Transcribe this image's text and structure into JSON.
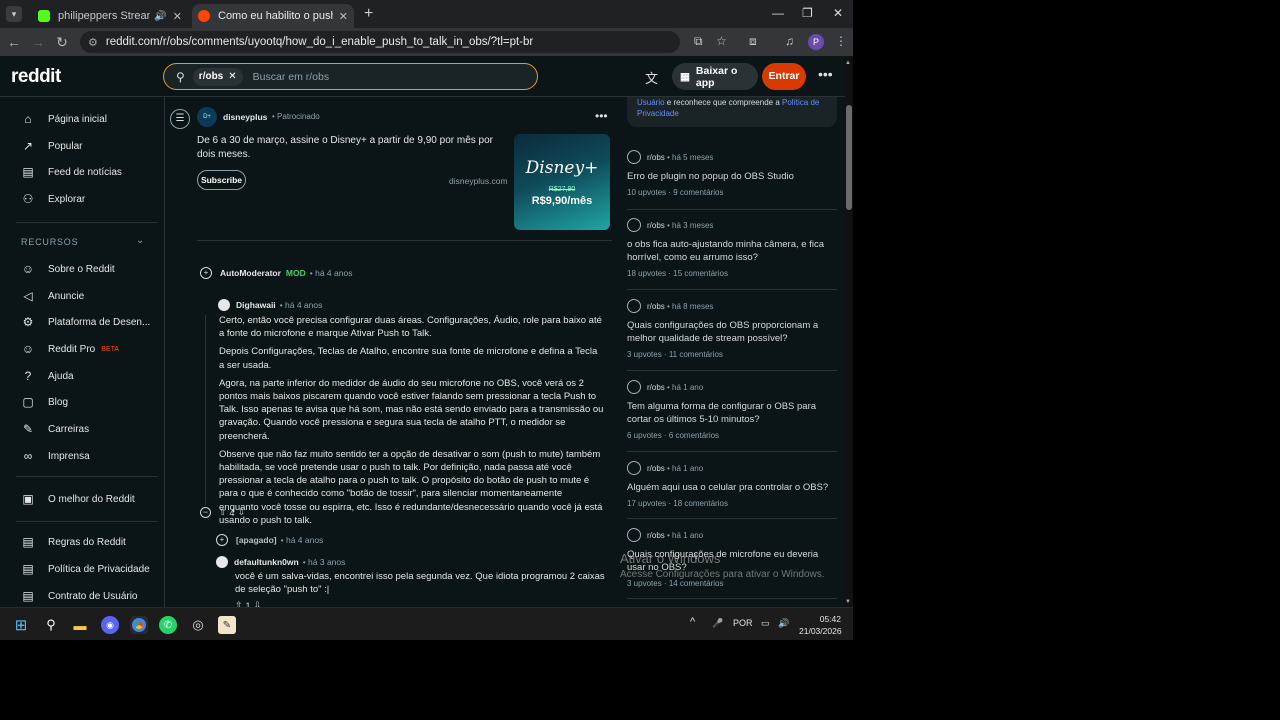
{
  "browser": {
    "tabs": [
      {
        "title": "philipeppers Stream - Watch",
        "active": false,
        "favicon_color": "#53fc18"
      },
      {
        "title": "Como eu habilito o push to talk",
        "active": true,
        "favicon_color": "#ff4500"
      }
    ],
    "url": "reddit.com/r/obs/comments/uyootq/how_do_i_enable_push_to_talk_in_obs/?tl=pt-br",
    "profile_initial": "P",
    "icons": [
      "back-icon",
      "forward-icon",
      "reload-icon",
      "tune-icon",
      "cast-icon",
      "bookmark-star-icon",
      "extensions-icon",
      "media-icon"
    ]
  },
  "header": {
    "logo": "reddit",
    "search_chip": "r/obs",
    "search_placeholder": "Buscar em r/obs",
    "get_app": "Baixar o app",
    "login": "Entrar"
  },
  "sidebar": {
    "items": [
      {
        "label": "Página inicial",
        "icon": "home-icon",
        "glyph": "⌂"
      },
      {
        "label": "Popular",
        "icon": "popular-icon",
        "glyph": "↗"
      },
      {
        "label": "Feed de notícias",
        "icon": "news-icon",
        "glyph": "▤"
      },
      {
        "label": "Explorar",
        "icon": "explore-icon",
        "glyph": "⚇"
      }
    ],
    "resources_heading": "RECURSOS",
    "resources": [
      {
        "label": "Sobre o Reddit",
        "icon": "reddit-icon",
        "glyph": "☺"
      },
      {
        "label": "Anuncie",
        "icon": "megaphone-icon",
        "glyph": "📢"
      },
      {
        "label": "Plataforma de Desen...",
        "icon": "developer-icon",
        "glyph": "⚙"
      },
      {
        "label": "Reddit Pro",
        "icon": "pro-icon",
        "glyph": "☺",
        "badge": "BETA"
      },
      {
        "label": "Ajuda",
        "icon": "help-icon",
        "glyph": "?"
      },
      {
        "label": "Blog",
        "icon": "blog-icon",
        "glyph": "▢"
      },
      {
        "label": "Carreiras",
        "icon": "careers-icon",
        "glyph": "✎"
      },
      {
        "label": "Imprensa",
        "icon": "press-icon",
        "glyph": "🔗"
      }
    ],
    "best_of": {
      "label": "O melhor do Reddit",
      "icon": "best-of-icon",
      "glyph": "▣"
    },
    "legal": [
      {
        "label": "Regras do Reddit",
        "icon": "rules-icon",
        "glyph": "▤"
      },
      {
        "label": "Política de Privacidade",
        "icon": "privacy-icon",
        "glyph": "▤"
      },
      {
        "label": "Contrato de Usuário",
        "icon": "agreement-icon",
        "glyph": "▤"
      }
    ]
  },
  "ad": {
    "user": "disneyplus",
    "promoted": "Patrocinado",
    "text": "De 6 a 30 de março, assine o Disney+ a partir de 9,90 por mês por dois meses.",
    "subscribe": "Subscribe",
    "domain": "disneyplus.com",
    "image_brand": "Disney+",
    "image_old_price": "R$27,90",
    "image_price": "R$9,90/mês"
  },
  "comments": [
    {
      "user": "AutoModerator",
      "mod": "MOD",
      "time": "há 4 anos"
    },
    {
      "user": "Dighawaii",
      "time": "há 4 anos",
      "paragraphs": [
        "Certo, então você precisa configurar duas áreas. Configurações, Áudio, role para baixo até a fonte do microfone e marque Ativar Push to Talk.",
        "Depois Configurações, Teclas de Atalho, encontre sua fonte de microfone e defina a Tecla a ser usada.",
        "Agora, na parte inferior do medidor de áudio do seu microfone no OBS, você verá os 2 pontos mais baixos piscarem quando você estiver falando sem pressionar a tecla Push to Talk. Isso apenas te avisa que há som, mas não está sendo enviado para a transmissão ou gravação. Quando você pressiona e segura sua tecla de atalho PTT, o medidor se preencherá.",
        "Observe que não faz muito sentido ter a opção de desativar o som (push to mute) também habilitada, se você pretende usar o push to talk. Por definição, nada passa até você pressionar a tecla de atalho para o push to talk. O propósito do botão de push to mute é para o que é conhecido como \"botão de tossir\", para silenciar momentaneamente enquanto você tosse ou espirra, etc. Isso é redundante/desnecessário quando você já está usando o push to talk."
      ],
      "score": "4"
    },
    {
      "user": "[apagado]",
      "time": "há 4 anos"
    },
    {
      "user": "defaultunkn0wn",
      "time": "há 3 anos",
      "text": "você é um salva-vidas, encontrei isso pela segunda vez. Que idiota programou 2 caixas de seleção \"push to\" :|",
      "score": "1"
    }
  ],
  "right_sidebar": {
    "top_link_1": "Usuário",
    "top_text": " e reconhece que compreende a ",
    "top_link_2": "Política de Privacidade",
    "posts": [
      {
        "sub": "r/obs",
        "time": "há 5 meses",
        "title": "Erro de plugin no popup do OBS Studio",
        "upvotes": "10 upvotes",
        "comments": "9 comentários"
      },
      {
        "sub": "r/obs",
        "time": "há 3 meses",
        "title": "o obs fica auto-ajustando minha câmera, e fica horrível, como eu arrumo isso?",
        "upvotes": "18 upvotes",
        "comments": "15 comentários"
      },
      {
        "sub": "r/obs",
        "time": "há 8 meses",
        "title": "Quais configurações do OBS proporcionam a melhor qualidade de stream possível?",
        "upvotes": "3 upvotes",
        "comments": "11 comentários"
      },
      {
        "sub": "r/obs",
        "time": "há 1 ano",
        "title": "Tem alguma forma de configurar o OBS para cortar os últimos 5-10 minutos?",
        "upvotes": "6 upvotes",
        "comments": "6 comentários"
      },
      {
        "sub": "r/obs",
        "time": "há 1 ano",
        "title": "Alguém aqui usa o celular pra controlar o OBS?",
        "upvotes": "17 upvotes",
        "comments": "18 comentários"
      },
      {
        "sub": "r/obs",
        "time": "há 1 ano",
        "title": "Quais configurações de microfone eu deveria usar no OBS?",
        "upvotes": "3 upvotes",
        "comments": "14 comentários"
      }
    ]
  },
  "watermark": {
    "line1": "Ativar o Windows",
    "line2": "Acesse Configurações para ativar o Windows."
  },
  "taskbar": {
    "lang": "POR",
    "time": "05:42",
    "date": "21/03/2026"
  }
}
